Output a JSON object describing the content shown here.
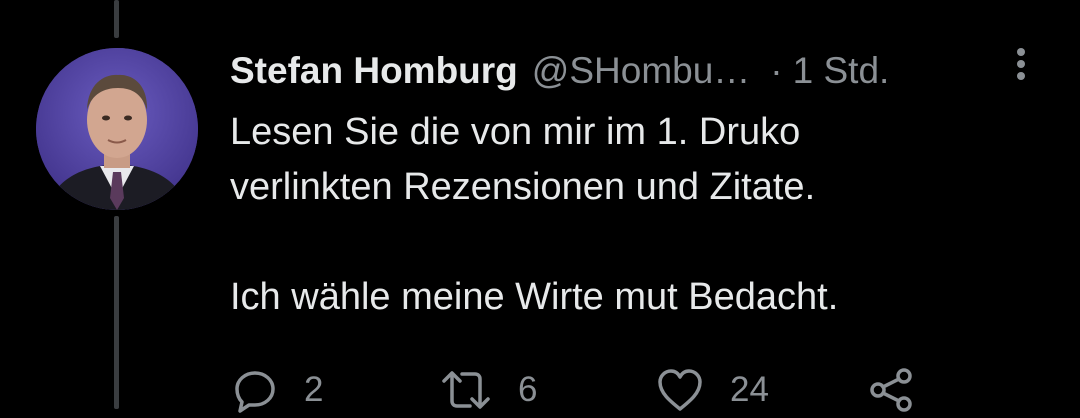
{
  "tweet": {
    "display_name": "Stefan Homburg",
    "handle": "@SHombu…",
    "separator": "·",
    "time": "1 Std.",
    "lines": [
      "Lesen Sie die von mir im 1. Druko",
      "verlinkten Rezensionen und Zitate.",
      "Ich wähle meine Wirte mut Bedacht."
    ],
    "actions": {
      "reply_count": "2",
      "retweet_count": "6",
      "like_count": "24"
    }
  },
  "icons": {
    "more": "more-vertical-icon",
    "reply": "reply-icon",
    "retweet": "retweet-icon",
    "like": "heart-icon",
    "share": "share-icon"
  },
  "colors": {
    "background": "#000000",
    "text": "#e7e9ea",
    "secondary_text": "#8b9095",
    "thread_line": "#3a3d40"
  }
}
